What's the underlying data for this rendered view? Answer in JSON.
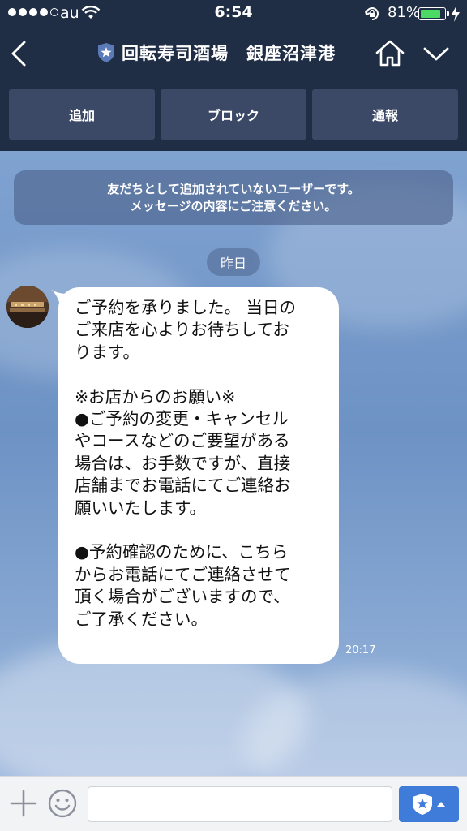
{
  "status_bar": {
    "carrier": "au",
    "time": "6:54",
    "battery_percent": "81%",
    "battery_level": 0.81,
    "signal_bars_filled": 4,
    "signal_bars_total": 5,
    "icons": [
      "wifi-icon",
      "rotation-lock-icon",
      "battery-icon",
      "charging-icon"
    ]
  },
  "header": {
    "title": "回転寿司酒場　銀座沼津港",
    "icons": [
      "back-icon",
      "official-badge-icon",
      "home-icon",
      "chevron-down-icon"
    ]
  },
  "actions": {
    "add_label": "追加",
    "block_label": "ブロック",
    "report_label": "通報"
  },
  "chat": {
    "notice_line1": "友だちとして追加されていないユーザーです。",
    "notice_line2": "メッセージの内容にご注意ください。",
    "date_label": "昨日",
    "message": {
      "lines": [
        "ご予約を承りました。 当日の",
        "ご来店を心よりお待ちしてお",
        "ります。",
        "",
        "※お店からのお願い※",
        "●ご予約の変更・キャンセル",
        "やコースなどのご要望がある",
        "場合は、お手数ですが、直接",
        "店舗までお電話にてご連絡お",
        "願いいたします。",
        "",
        "●予約確認のために、こちら",
        "からお電話にてご連絡させて",
        "頂く場合がございますので、",
        "ご了承ください。"
      ],
      "time": "20:17"
    }
  },
  "input_bar": {
    "placeholder": "",
    "icons": [
      "plus-icon",
      "emoji-icon",
      "stamp-icon"
    ]
  },
  "colors": {
    "header_bg": "#1f2d45",
    "action_button_bg": "#3b4966",
    "chat_bg": "#7fa2d1",
    "send_button": "#3f7bd8",
    "battery_fill": "#4cd964"
  }
}
